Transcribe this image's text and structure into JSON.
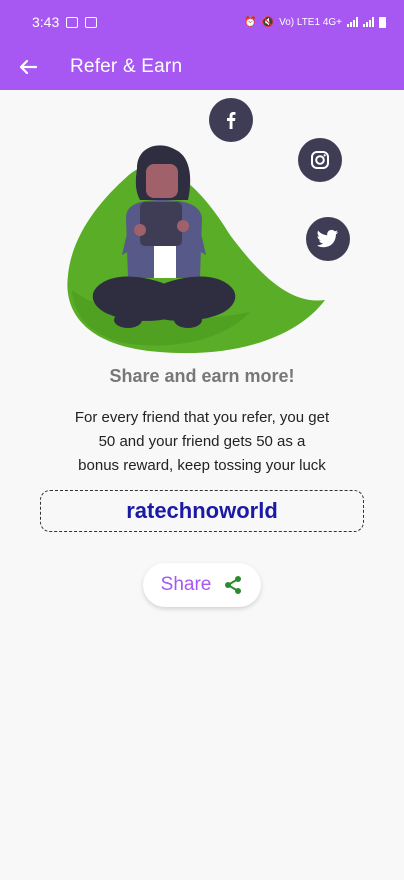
{
  "status_bar": {
    "time": "3:43",
    "network": "Vo) LTE1 4G+"
  },
  "app_bar": {
    "title": "Refer & Earn",
    "back_icon": "arrow-left-icon"
  },
  "illustration": {
    "social_icons": [
      "facebook-icon",
      "instagram-icon",
      "twitter-icon"
    ],
    "blob_color": "#5aad26"
  },
  "content": {
    "heading": "Share and earn more!",
    "description_lines": [
      "For every friend that you refer, you get",
      "50 and your friend gets 50 as a",
      "bonus reward, keep tossing your luck"
    ],
    "referral_code": "ratechnoworld",
    "share_label": "Share",
    "share_icon": "share-icon"
  },
  "colors": {
    "primary": "#a757f2",
    "code_text": "#1a1aa6",
    "share_icon": "#2e8b2e",
    "icon_circle": "#3f3d56"
  }
}
